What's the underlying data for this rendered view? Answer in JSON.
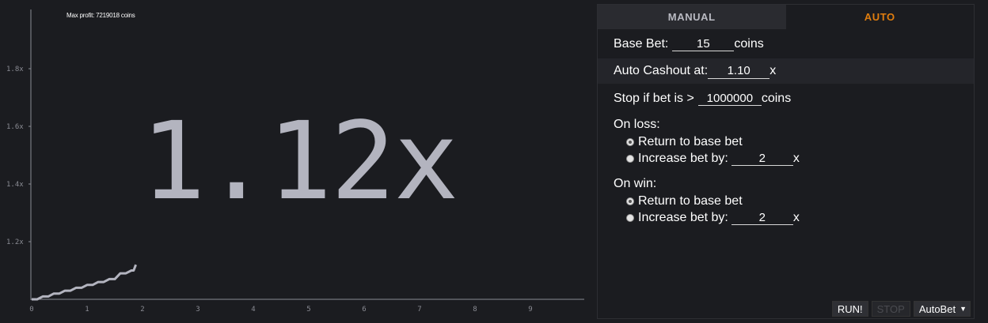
{
  "chart": {
    "max_profit": "Max profit: 7219018 coins",
    "multiplier": "1.12x",
    "y_ticks": [
      "1.2x",
      "1.4x",
      "1.6x",
      "1.8x"
    ],
    "x_ticks": [
      "0",
      "1",
      "2",
      "3",
      "4",
      "5",
      "6",
      "7",
      "8",
      "9"
    ]
  },
  "chart_data": {
    "type": "line",
    "title": "",
    "xlabel": "",
    "ylabel": "",
    "x": [
      0,
      0.2,
      0.4,
      0.6,
      0.8,
      1.0,
      1.2,
      1.4,
      1.6,
      1.8,
      1.88
    ],
    "y": [
      1.0,
      1.01,
      1.02,
      1.03,
      1.04,
      1.05,
      1.06,
      1.07,
      1.09,
      1.1,
      1.12
    ],
    "xlim": [
      0,
      10
    ],
    "ylim": [
      1.0,
      1.9
    ],
    "grid": false
  },
  "tabs": {
    "manual": "MANUAL",
    "auto": "AUTO"
  },
  "form": {
    "base_bet_label": "Base Bet:",
    "base_bet_value": "15",
    "base_bet_unit": "coins",
    "auto_cashout_label": "Auto Cashout at:",
    "auto_cashout_value": "1.10",
    "auto_cashout_unit": "x",
    "stop_label": "Stop if bet is >",
    "stop_value": "1000000",
    "stop_unit": "coins",
    "on_loss_label": "On loss:",
    "on_loss_return": "Return to base bet",
    "on_loss_increase": "Increase bet by:",
    "on_loss_increase_value": "2",
    "on_loss_unit": "x",
    "on_win_label": "On win:",
    "on_win_return": "Return to base bet",
    "on_win_increase": "Increase bet by:",
    "on_win_increase_value": "2",
    "on_win_unit": "x"
  },
  "buttons": {
    "run": "RUN!",
    "stop": "STOP",
    "autobet": "AutoBet",
    "autobet_arrow": "▼"
  }
}
